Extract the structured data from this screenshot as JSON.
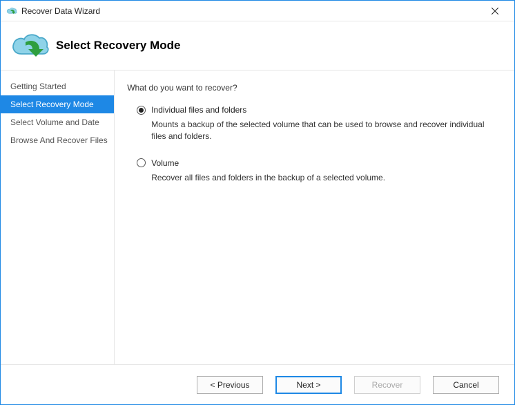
{
  "window": {
    "title": "Recover Data Wizard"
  },
  "header": {
    "title": "Select Recovery Mode"
  },
  "sidebar": {
    "items": [
      {
        "label": "Getting Started"
      },
      {
        "label": "Select Recovery Mode"
      },
      {
        "label": "Select Volume and Date"
      },
      {
        "label": "Browse And Recover Files"
      }
    ]
  },
  "content": {
    "question": "What do you want to recover?",
    "options": [
      {
        "label": "Individual files and folders",
        "description": "Mounts a backup of the selected volume that can be used to browse and recover individual files and folders.",
        "selected": true
      },
      {
        "label": "Volume",
        "description": "Recover all files and folders in the backup of a selected volume.",
        "selected": false
      }
    ]
  },
  "footer": {
    "previous": "< Previous",
    "next": "Next >",
    "recover": "Recover",
    "cancel": "Cancel"
  }
}
